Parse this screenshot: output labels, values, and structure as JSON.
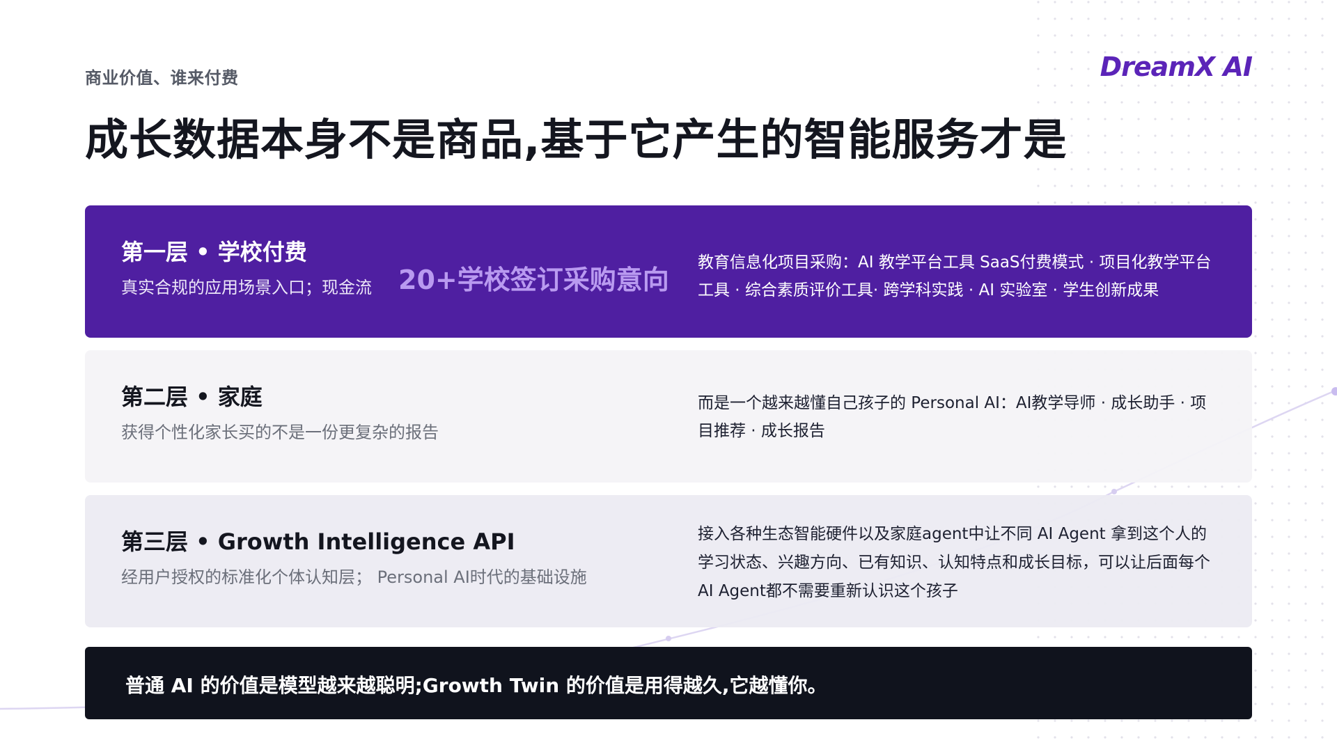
{
  "header": {
    "eyebrow": "商业价值、谁来付费",
    "logo": "DreamX AI",
    "title": "成长数据本身不是商品,基于它产生的智能服务才是"
  },
  "tiers": [
    {
      "name": "第一层 • 学校付费",
      "subtitle": "真实合规的应用场景入口；现金流",
      "highlight": "20+学校签订采购意向",
      "description": "教育信息化项目采购：AI 教学平台工具 SaaS付费模式 · 项目化教学平台工具 · 综合素质评价工具· 跨学科实践 · AI 实验室 · 学生创新成果"
    },
    {
      "name": "第二层 • 家庭",
      "subtitle": "获得个性化家长买的不是一份更复杂的报告",
      "description": "而是一个越来越懂自己孩子的  Personal AI：AI教学导师 · 成长助手 · 项目推荐 ·  成长报告"
    },
    {
      "name": "第三层 • Growth Intelligence API",
      "subtitle": "经用户授权的标准化个体认知层；   Personal AI时代的基础设施",
      "description": "接入各种生态智能硬件以及家庭agent中让不同 AI Agent 拿到这个人的学习状态、兴趣方向、已有知识、认知特点和成长目标，可以让后面每个 AI Agent都不需要重新认识这个孩子"
    }
  ],
  "footer": {
    "text": "普通 AI 的价值是模型越来越聪明;Growth Twin 的价值是用得越久,它越懂你。"
  },
  "colors": {
    "accent_purple": "#4f1fa1",
    "logo_purple": "#5b24b8",
    "highlight_lavender": "#b99af0",
    "dark_bar": "#10131d",
    "tier_light": "#f4f3f7"
  }
}
